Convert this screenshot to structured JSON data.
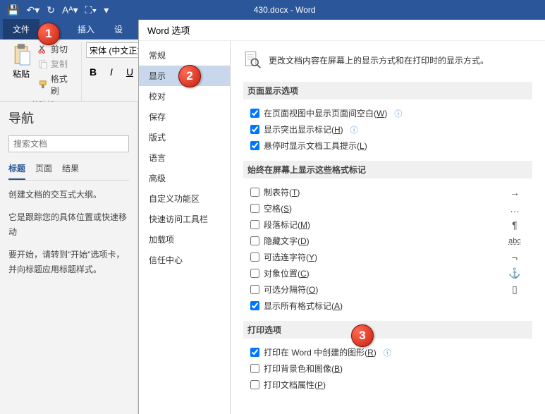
{
  "titlebar": {
    "title": "430.docx - Word"
  },
  "tabs": {
    "file": "文件",
    "home": "台",
    "insert": "插入",
    "design": "设"
  },
  "ribbon": {
    "paste": "粘贴",
    "cut": "剪切",
    "copy": "复制",
    "format_painter": "格式刷",
    "clipboard_group": "剪贴板",
    "font_name": "宋体 (中文正文",
    "bold": "B",
    "italic": "I",
    "underline": "U"
  },
  "nav": {
    "title": "导航",
    "search_ph": "搜索文档",
    "tab_headings": "标题",
    "tab_pages": "页面",
    "tab_results": "结果",
    "p1": "创建文档的交互式大纲。",
    "p2": "它是跟踪您的具体位置或快速移动",
    "p3": "要开始，请转到\"开始\"选项卡，并向标题应用标题样式。"
  },
  "dialog": {
    "title": "Word 选项",
    "sidebar": [
      "常规",
      "显示",
      "校对",
      "保存",
      "版式",
      "语言",
      "高级",
      "自定义功能区",
      "快速访问工具栏",
      "加载项",
      "信任中心"
    ],
    "active_index": 1,
    "description": "更改文档内容在屏幕上的显示方式和在打印时的显示方式。",
    "section_page": "页面显示选项",
    "page_opts": [
      {
        "label": "在页面视图中显示页面间空白(",
        "u": "W",
        "tail": ")",
        "checked": true,
        "info": true
      },
      {
        "label": "显示突出显示标记(",
        "u": "H",
        "tail": ")",
        "checked": true,
        "info": true
      },
      {
        "label": "悬停时显示文档工具提示(",
        "u": "L",
        "tail": ")",
        "checked": true
      }
    ],
    "section_marks": "始终在屏幕上显示这些格式标记",
    "mark_opts": [
      {
        "label": "制表符(",
        "u": "T",
        "tail": ")",
        "sym": "→"
      },
      {
        "label": "空格(",
        "u": "S",
        "tail": ")",
        "sym": "…"
      },
      {
        "label": "段落标记(",
        "u": "M",
        "tail": ")",
        "sym": "¶"
      },
      {
        "label": "隐藏文字(",
        "u": "D",
        "tail": ")",
        "sym": "abc",
        "abc": true
      },
      {
        "label": "可选连字符(",
        "u": "Y",
        "tail": ")",
        "sym": "¬"
      },
      {
        "label": "对象位置(",
        "u": "C",
        "tail": ")",
        "sym": "⚓"
      },
      {
        "label": "可选分隔符(",
        "u": "O",
        "tail": ")",
        "sym": "▯"
      },
      {
        "label": "显示所有格式标记(",
        "u": "A",
        "tail": ")",
        "checked": true
      }
    ],
    "section_print": "打印选项",
    "print_opts": [
      {
        "label": "打印在 Word 中创建的图形(",
        "u": "R",
        "tail": ")",
        "checked": true,
        "info": true
      },
      {
        "label": "打印背景色和图像(",
        "u": "B",
        "tail": ")"
      },
      {
        "label": "打印文档属性(",
        "u": "P",
        "tail": ")"
      }
    ]
  },
  "callouts": {
    "c1": "1",
    "c2": "2",
    "c3": "3"
  }
}
